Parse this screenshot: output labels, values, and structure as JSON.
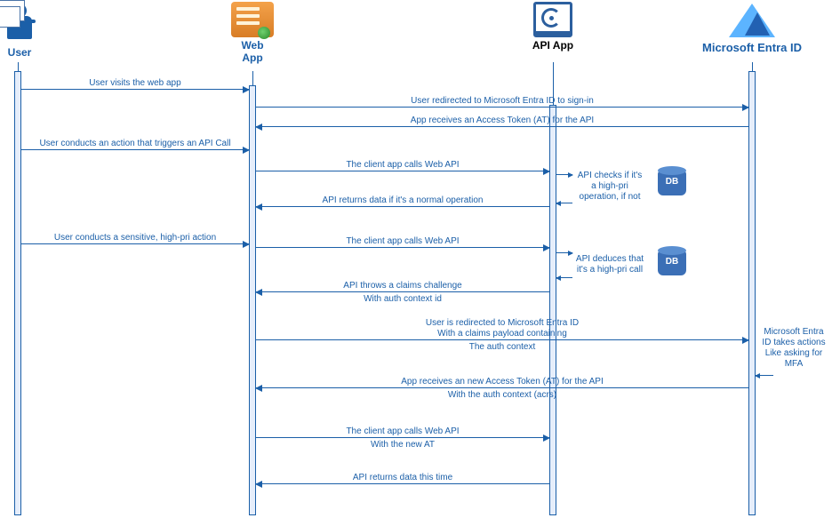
{
  "participants": {
    "user": "User",
    "web": "Web\nApp",
    "api": "API App",
    "entra": "Microsoft Entra ID"
  },
  "db_label": "DB",
  "messages": {
    "m1": "User visits the web app",
    "m2": "User redirected to Microsoft Entra ID to sign-in",
    "m3": "App receives an Access Token (AT) for the API",
    "m4": "User conducts an action that triggers an API Call",
    "m5": "The client app calls Web API",
    "m6": "API returns data if it's a normal operation",
    "m7": "User conducts a sensitive, high-pri action",
    "m8": "The client app calls Web API",
    "m9a": "API throws a claims challenge",
    "m9b": "With auth context id",
    "m10a": "User is redirected to Microsoft Entra ID",
    "m10b": "With a claims payload containing",
    "m10c": "The auth context",
    "m11a": "App receives an new Access Token (AT) for the API",
    "m11b": "With the auth context (acrs)",
    "m12a": "The client app calls Web API",
    "m12b": "With the new AT",
    "m13": "API returns data this time"
  },
  "notes": {
    "n1": "API checks if it's\na high-pri\noperation, if not",
    "n2": "API deduces that\nit's a high-pri call",
    "n3": "Microsoft Entra\nID takes actions\nLike asking for\nMFA"
  },
  "chart_data": {
    "type": "sequence",
    "title": "Step-up authentication with auth context — sequence",
    "participants": [
      "User",
      "Web App",
      "API App",
      "Microsoft Entra ID"
    ],
    "events": [
      {
        "from": "User",
        "to": "Web App",
        "label": "User visits the web app",
        "dir": "request"
      },
      {
        "from": "Web App",
        "to": "Microsoft Entra ID",
        "label": "User redirected to Microsoft Entra ID to sign-in",
        "dir": "request"
      },
      {
        "from": "Microsoft Entra ID",
        "to": "Web App",
        "label": "App receives an Access Token (AT) for the API",
        "dir": "response"
      },
      {
        "from": "User",
        "to": "Web App",
        "label": "User conducts an action that triggers an API Call",
        "dir": "request"
      },
      {
        "from": "Web App",
        "to": "API App",
        "label": "The client app calls Web API",
        "dir": "request"
      },
      {
        "at": "API App",
        "note": "API checks if it's a high-pri operation, if not",
        "type": "self"
      },
      {
        "from": "API App",
        "to": "Web App",
        "label": "API returns data if it's a normal operation",
        "dir": "response"
      },
      {
        "from": "User",
        "to": "Web App",
        "label": "User conducts a sensitive, high-pri action",
        "dir": "request"
      },
      {
        "from": "Web App",
        "to": "API App",
        "label": "The client app calls Web API",
        "dir": "request"
      },
      {
        "at": "API App",
        "note": "API deduces that it's a high-pri call",
        "type": "self"
      },
      {
        "from": "API App",
        "to": "Web App",
        "label": "API throws a claims challenge With auth context id",
        "dir": "response"
      },
      {
        "from": "Web App",
        "to": "Microsoft Entra ID",
        "label": "User is redirected to Microsoft Entra ID With a claims payload containing The auth context",
        "dir": "request"
      },
      {
        "at": "Microsoft Entra ID",
        "note": "Microsoft Entra ID takes actions Like asking for MFA",
        "type": "self"
      },
      {
        "from": "Microsoft Entra ID",
        "to": "Web App",
        "label": "App receives an new Access Token (AT) for the API With the auth context (acrs)",
        "dir": "response"
      },
      {
        "from": "Web App",
        "to": "API App",
        "label": "The client app calls Web API With the new AT",
        "dir": "request"
      },
      {
        "from": "API App",
        "to": "Web App",
        "label": "API returns data this time",
        "dir": "response"
      }
    ]
  }
}
